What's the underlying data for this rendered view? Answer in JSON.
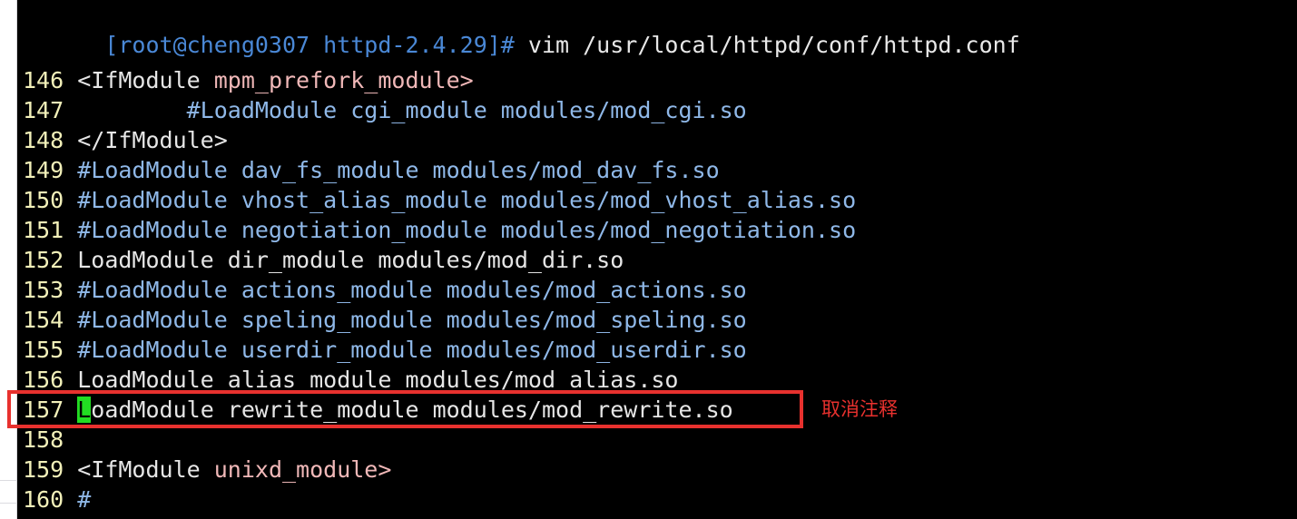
{
  "window": {
    "background": "#000000",
    "frame_color": "#ffffff"
  },
  "terminal": {
    "partial_top_line": "                                               ",
    "prompt": "[root@cheng0307 httpd-2.4.29]#",
    "command": " vim /usr/local/httpd/conf/httpd.conf",
    "colors": {
      "prompt": "#4a88d6",
      "command": "#e8e8e8",
      "line_number": "#f2f0b9",
      "comment": "#8fb8e8",
      "plain": "#e6e6e6",
      "tag_argument": "#f0b8b8",
      "cursor_bg": "#22dd22",
      "annotation": "#e8312e"
    }
  },
  "editor": {
    "file": "httpd.conf",
    "lines": [
      {
        "number": "146",
        "segments": [
          {
            "text": "<IfModule ",
            "style": "plain"
          },
          {
            "text": "mpm_prefork_module>",
            "style": "tag"
          }
        ]
      },
      {
        "number": "147",
        "segments": [
          {
            "text": "        #LoadModule cgi_module modules/mod_cgi.so",
            "style": "comment"
          }
        ]
      },
      {
        "number": "148",
        "segments": [
          {
            "text": "</IfModule>",
            "style": "plain"
          }
        ]
      },
      {
        "number": "149",
        "segments": [
          {
            "text": "#LoadModule dav_fs_module modules/mod_dav_fs.so",
            "style": "comment"
          }
        ]
      },
      {
        "number": "150",
        "segments": [
          {
            "text": "#LoadModule vhost_alias_module modules/mod_vhost_alias.so",
            "style": "comment"
          }
        ]
      },
      {
        "number": "151",
        "segments": [
          {
            "text": "#LoadModule negotiation_module modules/mod_negotiation.so",
            "style": "comment"
          }
        ]
      },
      {
        "number": "152",
        "segments": [
          {
            "text": "LoadModule dir_module modules/mod_dir.so",
            "style": "plain"
          }
        ]
      },
      {
        "number": "153",
        "segments": [
          {
            "text": "#LoadModule actions_module modules/mod_actions.so",
            "style": "comment"
          }
        ]
      },
      {
        "number": "154",
        "segments": [
          {
            "text": "#LoadModule speling_module modules/mod_speling.so",
            "style": "comment"
          }
        ]
      },
      {
        "number": "155",
        "segments": [
          {
            "text": "#LoadModule userdir_module modules/mod_userdir.so",
            "style": "comment"
          }
        ]
      },
      {
        "number": "156",
        "segments": [
          {
            "text": "LoadModule alias_module modules/mod_alias.so",
            "style": "plain"
          }
        ]
      },
      {
        "number": "157",
        "segments": [
          {
            "text": "L",
            "style": "cursor"
          },
          {
            "text": "oadModule rewrite_module modules/mod_rewrite.so",
            "style": "plain"
          }
        ]
      },
      {
        "number": "158",
        "segments": [
          {
            "text": "",
            "style": "plain"
          }
        ]
      },
      {
        "number": "159",
        "segments": [
          {
            "text": "<IfModule ",
            "style": "plain"
          },
          {
            "text": "unixd_module>",
            "style": "tag"
          }
        ]
      },
      {
        "number": "160",
        "segments": [
          {
            "text": "#",
            "style": "hash"
          }
        ]
      }
    ],
    "cursor": {
      "line": "157",
      "char": "L"
    }
  },
  "annotation": {
    "text": "取消注释",
    "color": "#e8312e",
    "highlighted_line": "157"
  }
}
